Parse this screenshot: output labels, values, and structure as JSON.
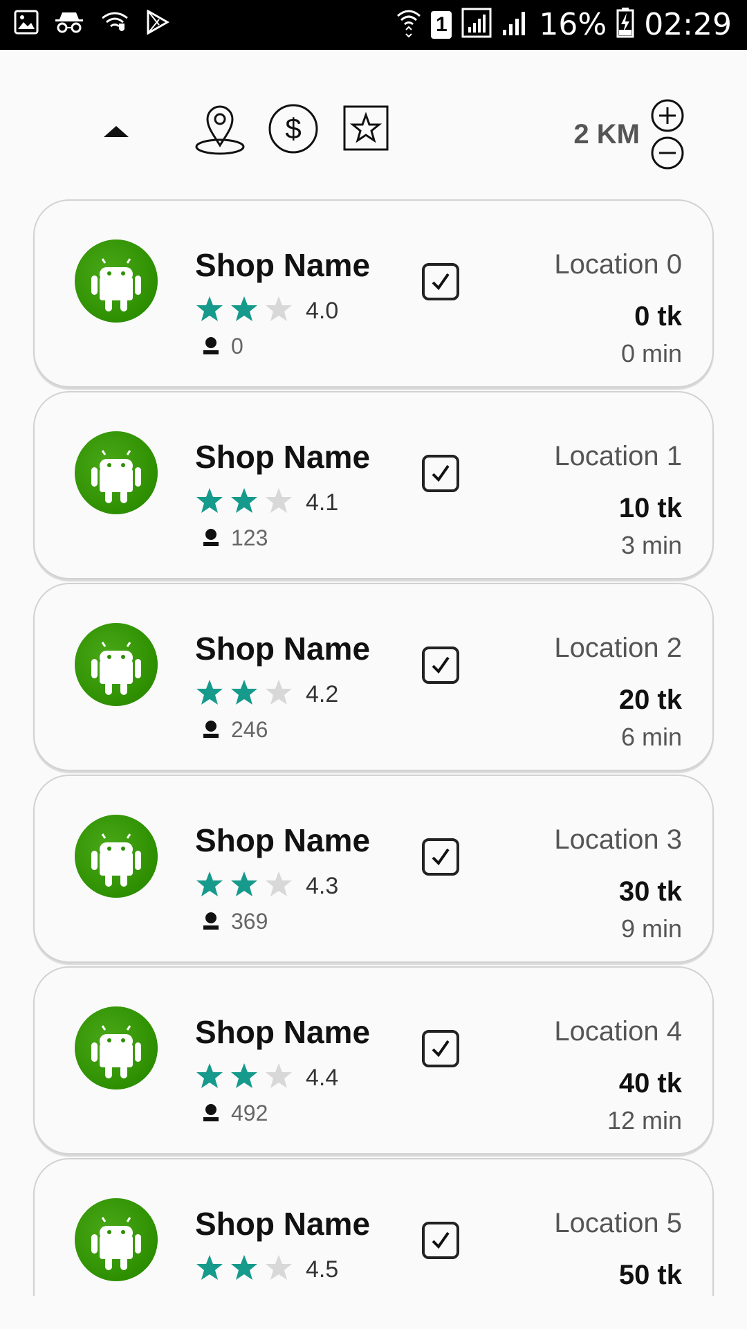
{
  "status_bar": {
    "battery": "16%",
    "time": "02:29",
    "sim": "1"
  },
  "toolbar": {
    "distance": "2 KM"
  },
  "shops": [
    {
      "name": "Shop Name",
      "rating": "4.0",
      "reviews": "0",
      "location": "Location 0",
      "price": "0 tk",
      "time": "0 min"
    },
    {
      "name": "Shop Name",
      "rating": "4.1",
      "reviews": "123",
      "location": "Location 1",
      "price": "10 tk",
      "time": "3 min"
    },
    {
      "name": "Shop Name",
      "rating": "4.2",
      "reviews": "246",
      "location": "Location 2",
      "price": "20 tk",
      "time": "6 min"
    },
    {
      "name": "Shop Name",
      "rating": "4.3",
      "reviews": "369",
      "location": "Location 3",
      "price": "30 tk",
      "time": "9 min"
    },
    {
      "name": "Shop Name",
      "rating": "4.4",
      "reviews": "492",
      "location": "Location 4",
      "price": "40 tk",
      "time": "12 min"
    },
    {
      "name": "Shop Name",
      "rating": "4.5",
      "reviews": "",
      "location": "Location 5",
      "price": "50 tk",
      "time": ""
    }
  ],
  "colors": {
    "star_filled": "#159a8c",
    "star_empty": "#d8d8d8",
    "logo_green": "#2d8f00"
  }
}
